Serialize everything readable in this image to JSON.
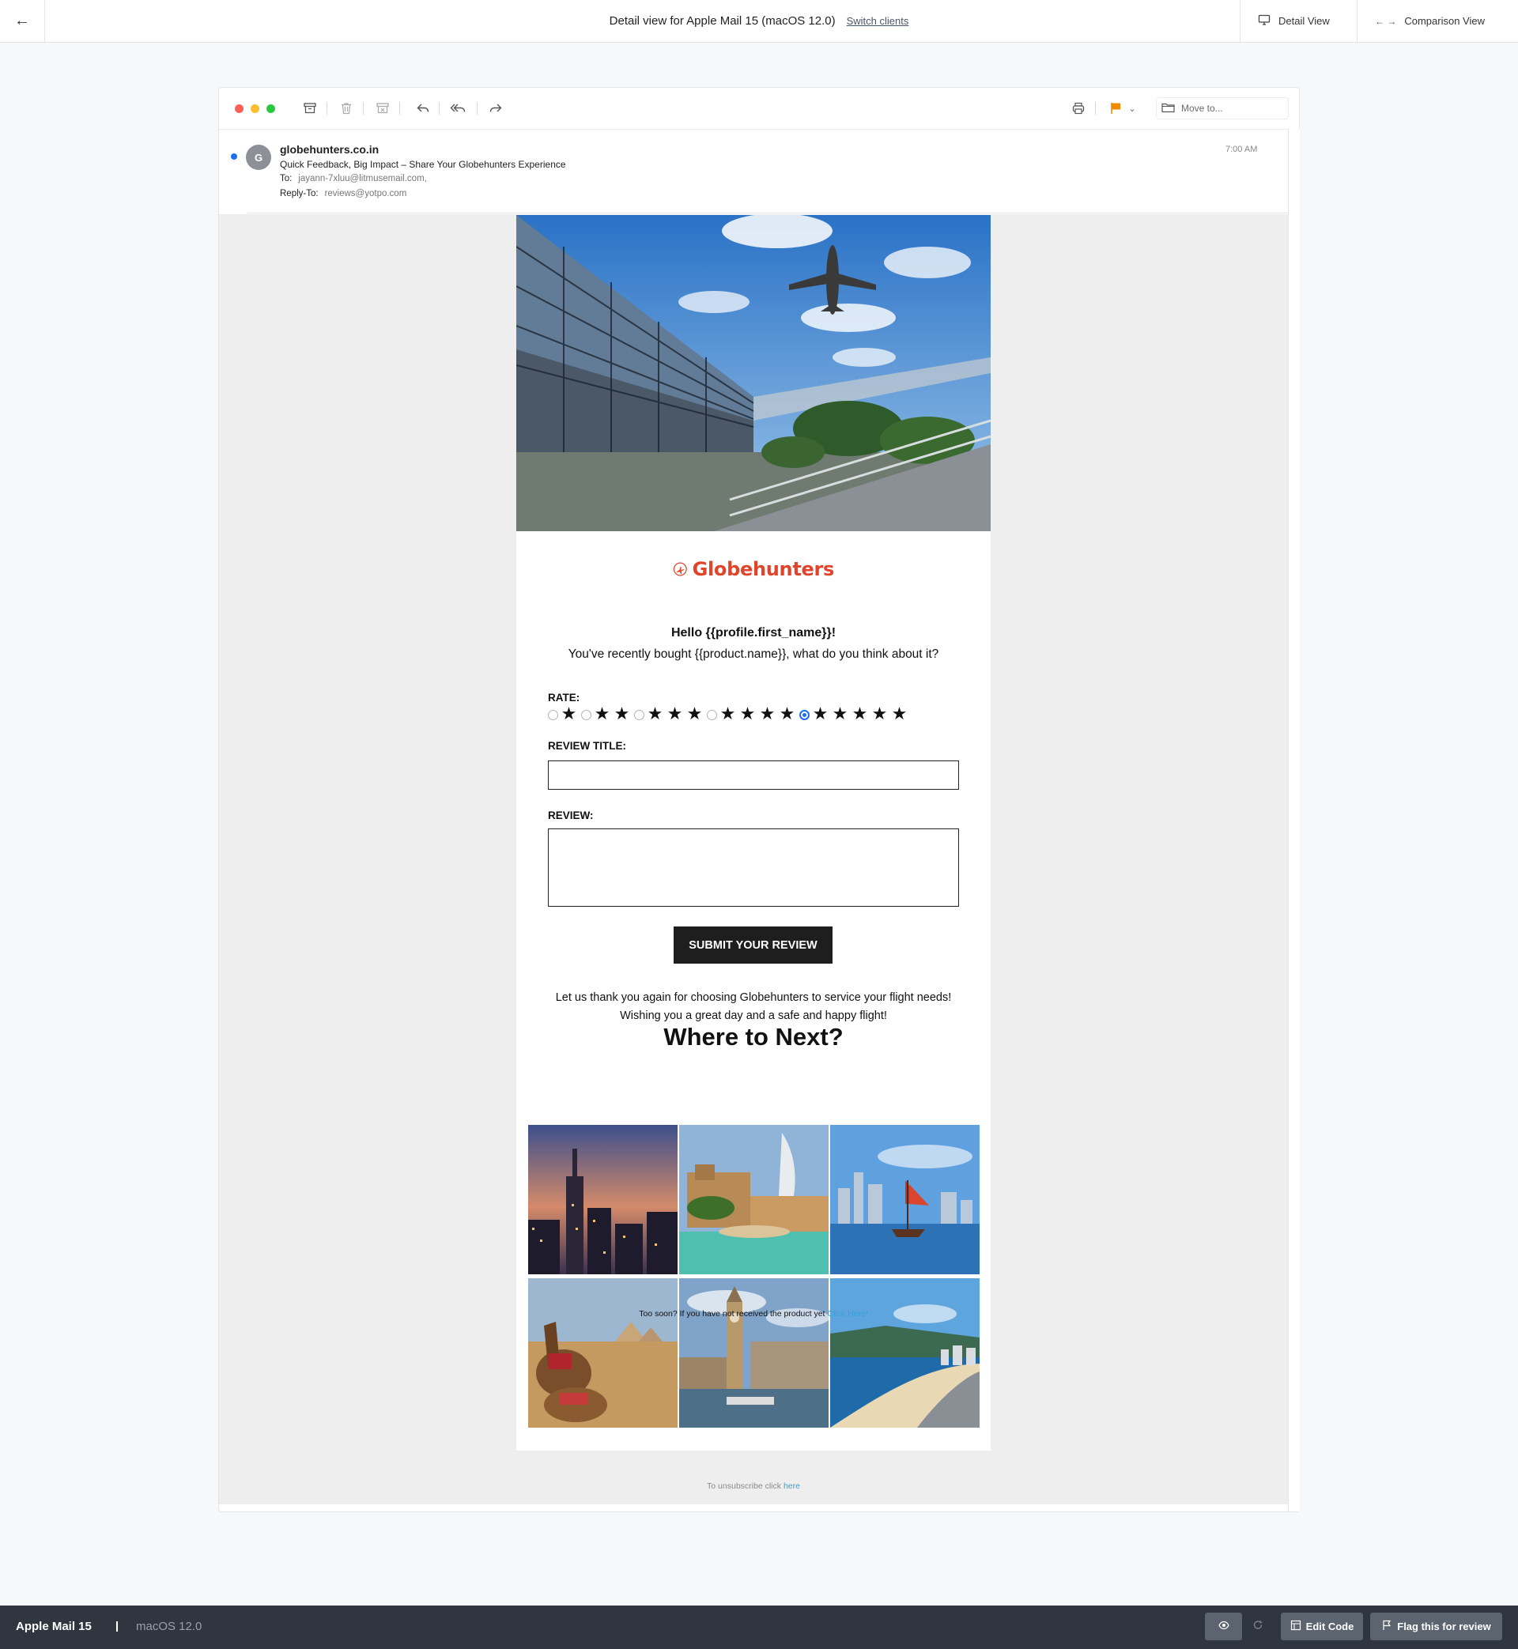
{
  "topbar": {
    "title": "Detail view for Apple Mail 15 (macOS 12.0)",
    "switch_label": "Switch clients",
    "detail_view_label": "Detail View",
    "comparison_view_label": "Comparison View"
  },
  "mail_toolbar": {
    "move_to_placeholder": "Move to...",
    "flag_color": "#f08a00"
  },
  "mail_header": {
    "avatar_initial": "G",
    "sender": "globehunters.co.in",
    "subject": "Quick Feedback, Big Impact – Share Your Globehunters Experience",
    "to_label": "To:",
    "to_value": "jayann-7xluu@litmusemail.com,",
    "reply_to_label": "Reply-To:",
    "reply_to_value": "reviews@yotpo.com",
    "time": "7:00 AM"
  },
  "email": {
    "brand": "Globehunters",
    "brand_color": "#e0452b",
    "hello": "Hello {{profile.first_name}}!",
    "intro": "You've recently bought {{product.name}}, what do you think about it?",
    "rate_label": "RATE:",
    "rating_options": [
      1,
      2,
      3,
      4,
      5
    ],
    "selected_rating": 5,
    "review_title_label": "REVIEW TITLE:",
    "review_label": "REVIEW:",
    "submit_label": "SUBMIT YOUR REVIEW",
    "thanks_line1": "Let us thank you again for choosing Globehunters to service your flight needs!",
    "thanks_line2": "Wishing you a great day and a safe and happy flight!",
    "next_title": "Where to Next?",
    "destinations": [
      "new-york",
      "dubai",
      "hong-kong",
      "egypt",
      "london",
      "rio-de-janeiro"
    ],
    "too_soon_text": "Too soon? If you have not received the product yet",
    "too_soon_link": "Click Here!",
    "unsubscribe_text": "To unsubscribe click",
    "unsubscribe_link": "here"
  },
  "bottombar": {
    "client": "Apple Mail 15",
    "os": "macOS 12.0",
    "edit_code_label": "Edit Code",
    "flag_review_label": "Flag this for review"
  }
}
